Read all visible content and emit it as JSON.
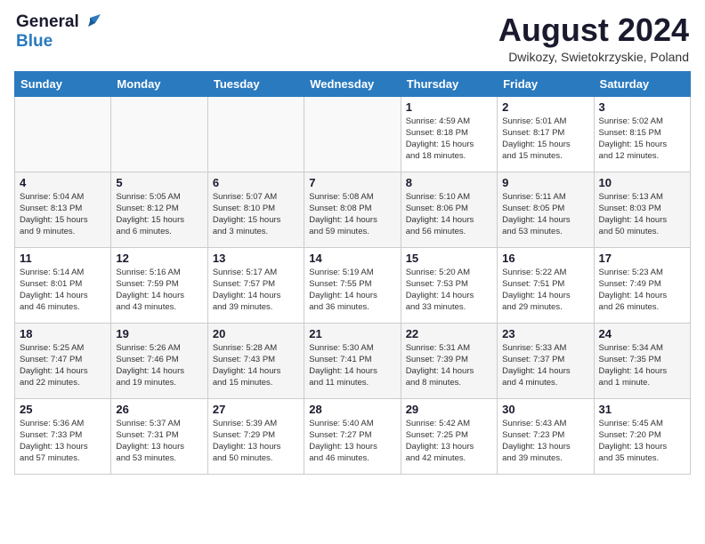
{
  "header": {
    "logo_general": "General",
    "logo_blue": "Blue",
    "month_year": "August 2024",
    "location": "Dwikozy, Swietokrzyskie, Poland"
  },
  "days_of_week": [
    "Sunday",
    "Monday",
    "Tuesday",
    "Wednesday",
    "Thursday",
    "Friday",
    "Saturday"
  ],
  "weeks": [
    [
      {
        "num": "",
        "info": "",
        "empty": true
      },
      {
        "num": "",
        "info": "",
        "empty": true
      },
      {
        "num": "",
        "info": "",
        "empty": true
      },
      {
        "num": "",
        "info": "",
        "empty": true
      },
      {
        "num": "1",
        "info": "Sunrise: 4:59 AM\nSunset: 8:18 PM\nDaylight: 15 hours\nand 18 minutes.",
        "empty": false
      },
      {
        "num": "2",
        "info": "Sunrise: 5:01 AM\nSunset: 8:17 PM\nDaylight: 15 hours\nand 15 minutes.",
        "empty": false
      },
      {
        "num": "3",
        "info": "Sunrise: 5:02 AM\nSunset: 8:15 PM\nDaylight: 15 hours\nand 12 minutes.",
        "empty": false
      }
    ],
    [
      {
        "num": "4",
        "info": "Sunrise: 5:04 AM\nSunset: 8:13 PM\nDaylight: 15 hours\nand 9 minutes.",
        "empty": false
      },
      {
        "num": "5",
        "info": "Sunrise: 5:05 AM\nSunset: 8:12 PM\nDaylight: 15 hours\nand 6 minutes.",
        "empty": false
      },
      {
        "num": "6",
        "info": "Sunrise: 5:07 AM\nSunset: 8:10 PM\nDaylight: 15 hours\nand 3 minutes.",
        "empty": false
      },
      {
        "num": "7",
        "info": "Sunrise: 5:08 AM\nSunset: 8:08 PM\nDaylight: 14 hours\nand 59 minutes.",
        "empty": false
      },
      {
        "num": "8",
        "info": "Sunrise: 5:10 AM\nSunset: 8:06 PM\nDaylight: 14 hours\nand 56 minutes.",
        "empty": false
      },
      {
        "num": "9",
        "info": "Sunrise: 5:11 AM\nSunset: 8:05 PM\nDaylight: 14 hours\nand 53 minutes.",
        "empty": false
      },
      {
        "num": "10",
        "info": "Sunrise: 5:13 AM\nSunset: 8:03 PM\nDaylight: 14 hours\nand 50 minutes.",
        "empty": false
      }
    ],
    [
      {
        "num": "11",
        "info": "Sunrise: 5:14 AM\nSunset: 8:01 PM\nDaylight: 14 hours\nand 46 minutes.",
        "empty": false
      },
      {
        "num": "12",
        "info": "Sunrise: 5:16 AM\nSunset: 7:59 PM\nDaylight: 14 hours\nand 43 minutes.",
        "empty": false
      },
      {
        "num": "13",
        "info": "Sunrise: 5:17 AM\nSunset: 7:57 PM\nDaylight: 14 hours\nand 39 minutes.",
        "empty": false
      },
      {
        "num": "14",
        "info": "Sunrise: 5:19 AM\nSunset: 7:55 PM\nDaylight: 14 hours\nand 36 minutes.",
        "empty": false
      },
      {
        "num": "15",
        "info": "Sunrise: 5:20 AM\nSunset: 7:53 PM\nDaylight: 14 hours\nand 33 minutes.",
        "empty": false
      },
      {
        "num": "16",
        "info": "Sunrise: 5:22 AM\nSunset: 7:51 PM\nDaylight: 14 hours\nand 29 minutes.",
        "empty": false
      },
      {
        "num": "17",
        "info": "Sunrise: 5:23 AM\nSunset: 7:49 PM\nDaylight: 14 hours\nand 26 minutes.",
        "empty": false
      }
    ],
    [
      {
        "num": "18",
        "info": "Sunrise: 5:25 AM\nSunset: 7:47 PM\nDaylight: 14 hours\nand 22 minutes.",
        "empty": false
      },
      {
        "num": "19",
        "info": "Sunrise: 5:26 AM\nSunset: 7:46 PM\nDaylight: 14 hours\nand 19 minutes.",
        "empty": false
      },
      {
        "num": "20",
        "info": "Sunrise: 5:28 AM\nSunset: 7:43 PM\nDaylight: 14 hours\nand 15 minutes.",
        "empty": false
      },
      {
        "num": "21",
        "info": "Sunrise: 5:30 AM\nSunset: 7:41 PM\nDaylight: 14 hours\nand 11 minutes.",
        "empty": false
      },
      {
        "num": "22",
        "info": "Sunrise: 5:31 AM\nSunset: 7:39 PM\nDaylight: 14 hours\nand 8 minutes.",
        "empty": false
      },
      {
        "num": "23",
        "info": "Sunrise: 5:33 AM\nSunset: 7:37 PM\nDaylight: 14 hours\nand 4 minutes.",
        "empty": false
      },
      {
        "num": "24",
        "info": "Sunrise: 5:34 AM\nSunset: 7:35 PM\nDaylight: 14 hours\nand 1 minute.",
        "empty": false
      }
    ],
    [
      {
        "num": "25",
        "info": "Sunrise: 5:36 AM\nSunset: 7:33 PM\nDaylight: 13 hours\nand 57 minutes.",
        "empty": false
      },
      {
        "num": "26",
        "info": "Sunrise: 5:37 AM\nSunset: 7:31 PM\nDaylight: 13 hours\nand 53 minutes.",
        "empty": false
      },
      {
        "num": "27",
        "info": "Sunrise: 5:39 AM\nSunset: 7:29 PM\nDaylight: 13 hours\nand 50 minutes.",
        "empty": false
      },
      {
        "num": "28",
        "info": "Sunrise: 5:40 AM\nSunset: 7:27 PM\nDaylight: 13 hours\nand 46 minutes.",
        "empty": false
      },
      {
        "num": "29",
        "info": "Sunrise: 5:42 AM\nSunset: 7:25 PM\nDaylight: 13 hours\nand 42 minutes.",
        "empty": false
      },
      {
        "num": "30",
        "info": "Sunrise: 5:43 AM\nSunset: 7:23 PM\nDaylight: 13 hours\nand 39 minutes.",
        "empty": false
      },
      {
        "num": "31",
        "info": "Sunrise: 5:45 AM\nSunset: 7:20 PM\nDaylight: 13 hours\nand 35 minutes.",
        "empty": false
      }
    ]
  ]
}
